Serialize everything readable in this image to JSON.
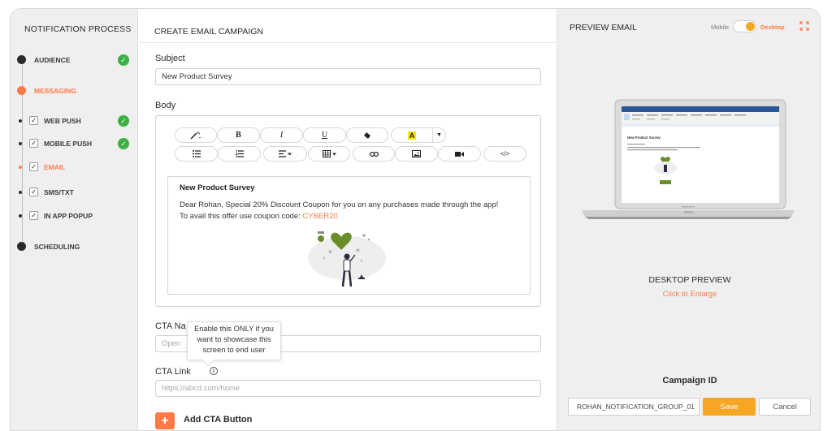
{
  "sidebar": {
    "title": "NOTIFICATION PROCESS",
    "steps": [
      {
        "label": "AUDIENCE",
        "done": true
      },
      {
        "label": "MESSAGING",
        "active": true
      },
      {
        "label": "SCHEDULING"
      }
    ],
    "substeps": [
      {
        "label": "WEB PUSH",
        "done": true
      },
      {
        "label": "MOBILE PUSH",
        "done": true
      },
      {
        "label": "EMAIL",
        "active": true
      },
      {
        "label": "SMS/TXT"
      },
      {
        "label": "IN APP POPUP"
      }
    ]
  },
  "main": {
    "header": "CREATE EMAIL CAMPAIGN",
    "subject_label": "Subject",
    "subject_value": "New Product Survey",
    "body_label": "Body",
    "toolbar": {
      "bold": "B",
      "italic": "I",
      "underline": "U",
      "highlight": "A",
      "code": "</>"
    },
    "email": {
      "title": "New Product Survey",
      "body_text": "Dear Rohan, Special 20% Discount Coupon for you on any purchases made through the app! To avail this offer use coupon code:",
      "coupon": "CYBER20"
    },
    "cta_name_label": "CTA Na",
    "cta_name_placeholder": "Open",
    "tooltip": "Enable this ONLY if you want to showcase this screen to end user",
    "cta_link_label": "CTA Link",
    "cta_link_placeholder": "https://abcd.com/home",
    "add_cta_label": "Add CTA Button"
  },
  "preview": {
    "title": "PREVIEW EMAIL",
    "mobile_label": "Mobile",
    "desktop_label": "Desktop",
    "laptop_caption": "MacBook Air",
    "mini_email_title": "New Product Survey",
    "desktop_preview_title": "DESKTOP PREVIEW",
    "enlarge_link": "Click to Enlarge",
    "campaign_id_label": "Campaign ID",
    "campaign_id_value": "ROHAN_NOTIFICATION_GROUP_01",
    "save_label": "Save",
    "cancel_label": "Cancel"
  },
  "colors": {
    "accent": "#ff7a45",
    "save": "#f5a623",
    "check": "#3cb043",
    "heart": "#6a8f2a"
  }
}
